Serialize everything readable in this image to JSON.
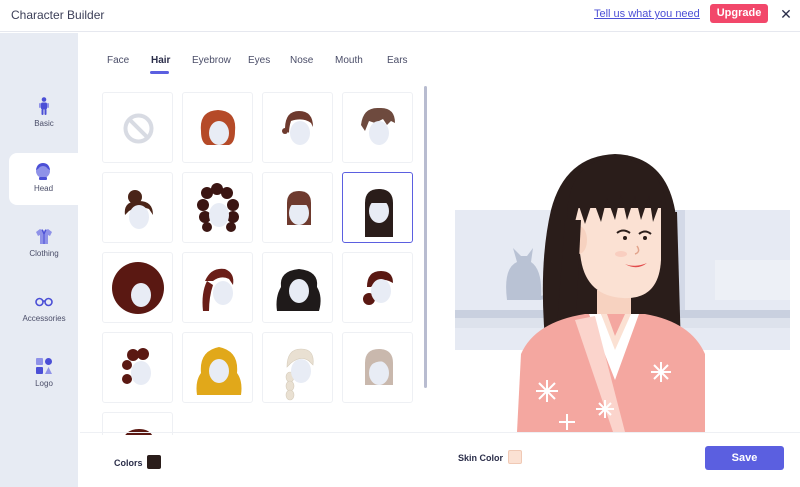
{
  "header": {
    "title": "Character Builder",
    "help_link": "Tell us what you need",
    "upgrade_label": "Upgrade",
    "close_icon": "close-icon"
  },
  "sidebar": {
    "items": [
      {
        "label": "Basic",
        "icon": "body-icon"
      },
      {
        "label": "Head",
        "icon": "head-icon",
        "active": true
      },
      {
        "label": "Clothing",
        "icon": "shirt-icon"
      },
      {
        "label": "Accessories",
        "icon": "glasses-icon"
      },
      {
        "label": "Logo",
        "icon": "shapes-icon"
      }
    ]
  },
  "tabs": [
    {
      "label": "Face"
    },
    {
      "label": "Hair",
      "active": true
    },
    {
      "label": "Eyebrow"
    },
    {
      "label": "Eyes"
    },
    {
      "label": "Nose"
    },
    {
      "label": "Mouth"
    },
    {
      "label": "Ears"
    }
  ],
  "hair_grid": {
    "selected_index": 7,
    "options": [
      {
        "name": "none",
        "color": "#d8dbe3"
      },
      {
        "name": "short-bob",
        "color": "#b54a28"
      },
      {
        "name": "pigtail-short",
        "color": "#6e3a2e"
      },
      {
        "name": "messy-short",
        "color": "#6e4a3e"
      },
      {
        "name": "top-bun",
        "color": "#4a2418"
      },
      {
        "name": "curly-long",
        "color": "#3b1512"
      },
      {
        "name": "bob-bangs",
        "color": "#6e3a2e"
      },
      {
        "name": "long-straight-bangs",
        "color": "#2a1d1a"
      },
      {
        "name": "afro",
        "color": "#5a1812"
      },
      {
        "name": "ponytail",
        "color": "#6a1e18"
      },
      {
        "name": "wavy-long",
        "color": "#1f1a1a"
      },
      {
        "name": "side-bun",
        "color": "#5a1812"
      },
      {
        "name": "short-curly",
        "color": "#5a1812"
      },
      {
        "name": "curly-blonde",
        "color": "#e1a81a"
      },
      {
        "name": "braid-blonde",
        "color": "#e9e0d2"
      },
      {
        "name": "bob-gray",
        "color": "#c9b8ad"
      },
      {
        "name": "short-dark",
        "color": "#5a1812"
      }
    ]
  },
  "footer": {
    "colors_label": "Colors",
    "hair_color": "#2a1d1a",
    "skin_label": "Skin Color",
    "skin_color": "#fbe1d3",
    "save_label": "Save"
  },
  "theme": {
    "accent": "#5b5fe0",
    "upgrade": "#f2476a",
    "sidebar_bg": "#e7ebf3"
  }
}
